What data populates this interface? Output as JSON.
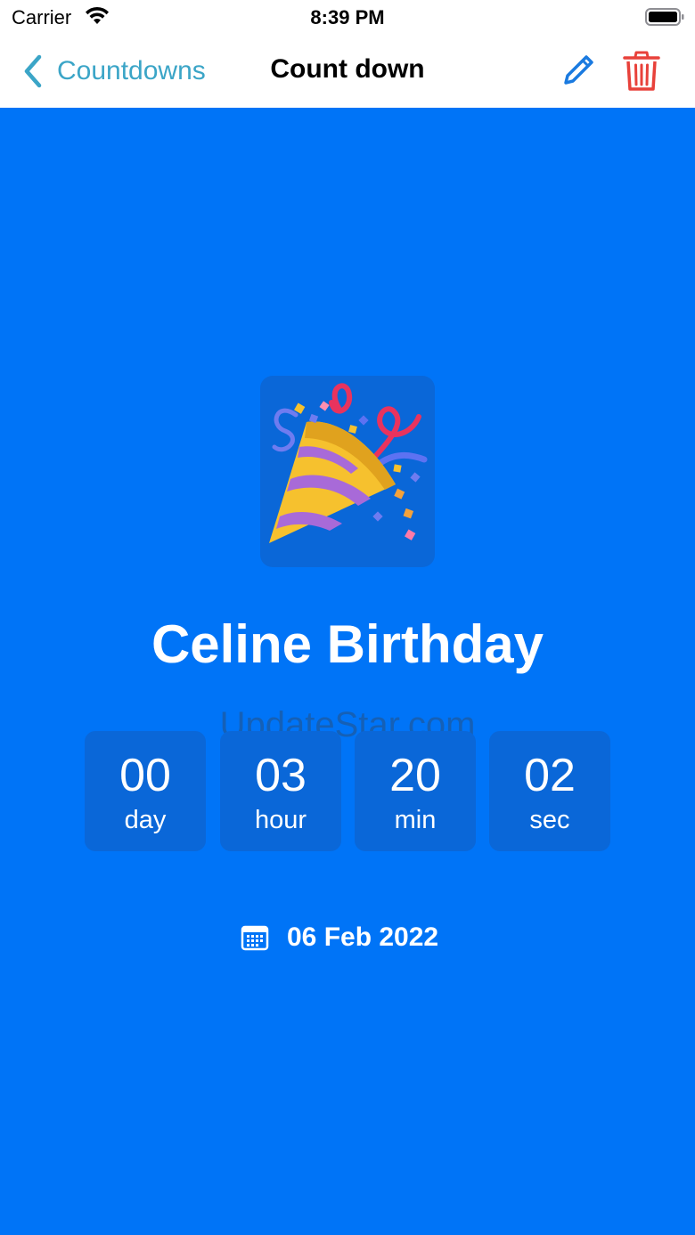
{
  "status_bar": {
    "carrier": "Carrier",
    "time": "8:39 PM"
  },
  "nav": {
    "back_label": "Countdowns",
    "title": "Count down",
    "edit_icon": "pencil-icon",
    "delete_icon": "trash-icon"
  },
  "event": {
    "icon": "party-popper-emoji",
    "title": "Celine Birthday",
    "date": "06 Feb 2022"
  },
  "countdown": [
    {
      "value": "00",
      "unit": "day"
    },
    {
      "value": "03",
      "unit": "hour"
    },
    {
      "value": "20",
      "unit": "min"
    },
    {
      "value": "02",
      "unit": "sec"
    }
  ],
  "watermark": "UpdateStar.com",
  "colors": {
    "background": "#0074f7",
    "tile": "#0a67d8",
    "accent": "#3ba5c7",
    "edit": "#1a7ae0",
    "delete": "#e8413a"
  }
}
